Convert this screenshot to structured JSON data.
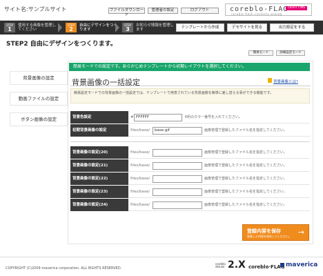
{
  "header": {
    "site_name": "サイト名:サンプルサイト",
    "buttons": [
      "ファイルダウンロード",
      "管理者の設定",
      "ログアウト"
    ],
    "logo": {
      "text": "coreblo-FLAG",
      "badge": "LIGHT CMS",
      "subtitle": "coreblo flash contents analog"
    }
  },
  "steps": [
    {
      "step": "STEP",
      "num": "1",
      "label": "使用する画像を管理してください"
    },
    {
      "step": "STEP",
      "num": "2",
      "label": "自由にデザインをつくります"
    },
    {
      "step": "STEP",
      "num": "3",
      "label": "お知らせ情報を管理します"
    }
  ],
  "step_buttons": [
    "テンプレートから作成",
    "デモサイトを見る",
    "出力設定をする"
  ],
  "page": {
    "title": "STEP2 自由にデザインをつくります。",
    "mode_buttons": [
      "簡易モード",
      "詳細設定モード"
    ]
  },
  "sidebar": {
    "items": [
      {
        "label": "背景画像の設定"
      },
      {
        "label": "動画ファイルの設定"
      },
      {
        "label": "ボタン画像の設定"
      }
    ]
  },
  "main": {
    "notice": "簡易モードでの設定です。あらかじめテンプレートから初期レイアウトを選択してください。",
    "title": "背景画像の一括設定",
    "help_link": "背景画像とは?",
    "description": "簡易設定モードでの背景画像の一括設定では、テンプレートで用意されている背景画像を簡単に差し替える事ができる機能です。",
    "rows": [
      {
        "label": "背景色設定",
        "prefix": "#",
        "value": "FFFFFF",
        "hint": "6桁のカラー番号を入れてください。"
      },
      {
        "label": "初期背景画像の設定",
        "prefix": "files/base/",
        "value": "base.gif",
        "hint": "画像管理で登録したファイル名を指定してください。"
      },
      {
        "label": "背景画像の設定(20)",
        "prefix": "files/base/",
        "value": "",
        "hint": "画像管理で登録したファイル名を指定してください。"
      },
      {
        "label": "背景画像の設定(21)",
        "prefix": "files/base/",
        "value": "",
        "hint": "画像管理で登録したファイル名を指定してください。"
      },
      {
        "label": "背景画像の設定(22)",
        "prefix": "files/base/",
        "value": "",
        "hint": "画像管理で登録したファイル名を指定してください。"
      },
      {
        "label": "背景画像の設定(23)",
        "prefix": "files/base/",
        "value": "",
        "hint": "画像管理で登録したファイル名を指定してください。"
      },
      {
        "label": "背景画像の設定(24)",
        "prefix": "files/base/",
        "value": "",
        "hint": "画像管理で登録したファイル名を指定してください。"
      }
    ],
    "save": {
      "label": "登録内容を保存",
      "sub": "登録した内容を保存してください。",
      "arrow": "→"
    }
  },
  "footer": {
    "copyright": "COPYRIGHT (C)2009 maverica corporation. ALL RIGHTS RESERVED.",
    "logos": {
      "ver_small": "coreblo\ndeluxe",
      "ver_big": "2.X",
      "flag": "coreblo·FLAG",
      "maverica": "maverica"
    }
  },
  "colors": {
    "accent": "#f08c1e",
    "notice": "#19a56b",
    "label_bg": "#3a3a3a",
    "link": "#1a4ea8"
  }
}
